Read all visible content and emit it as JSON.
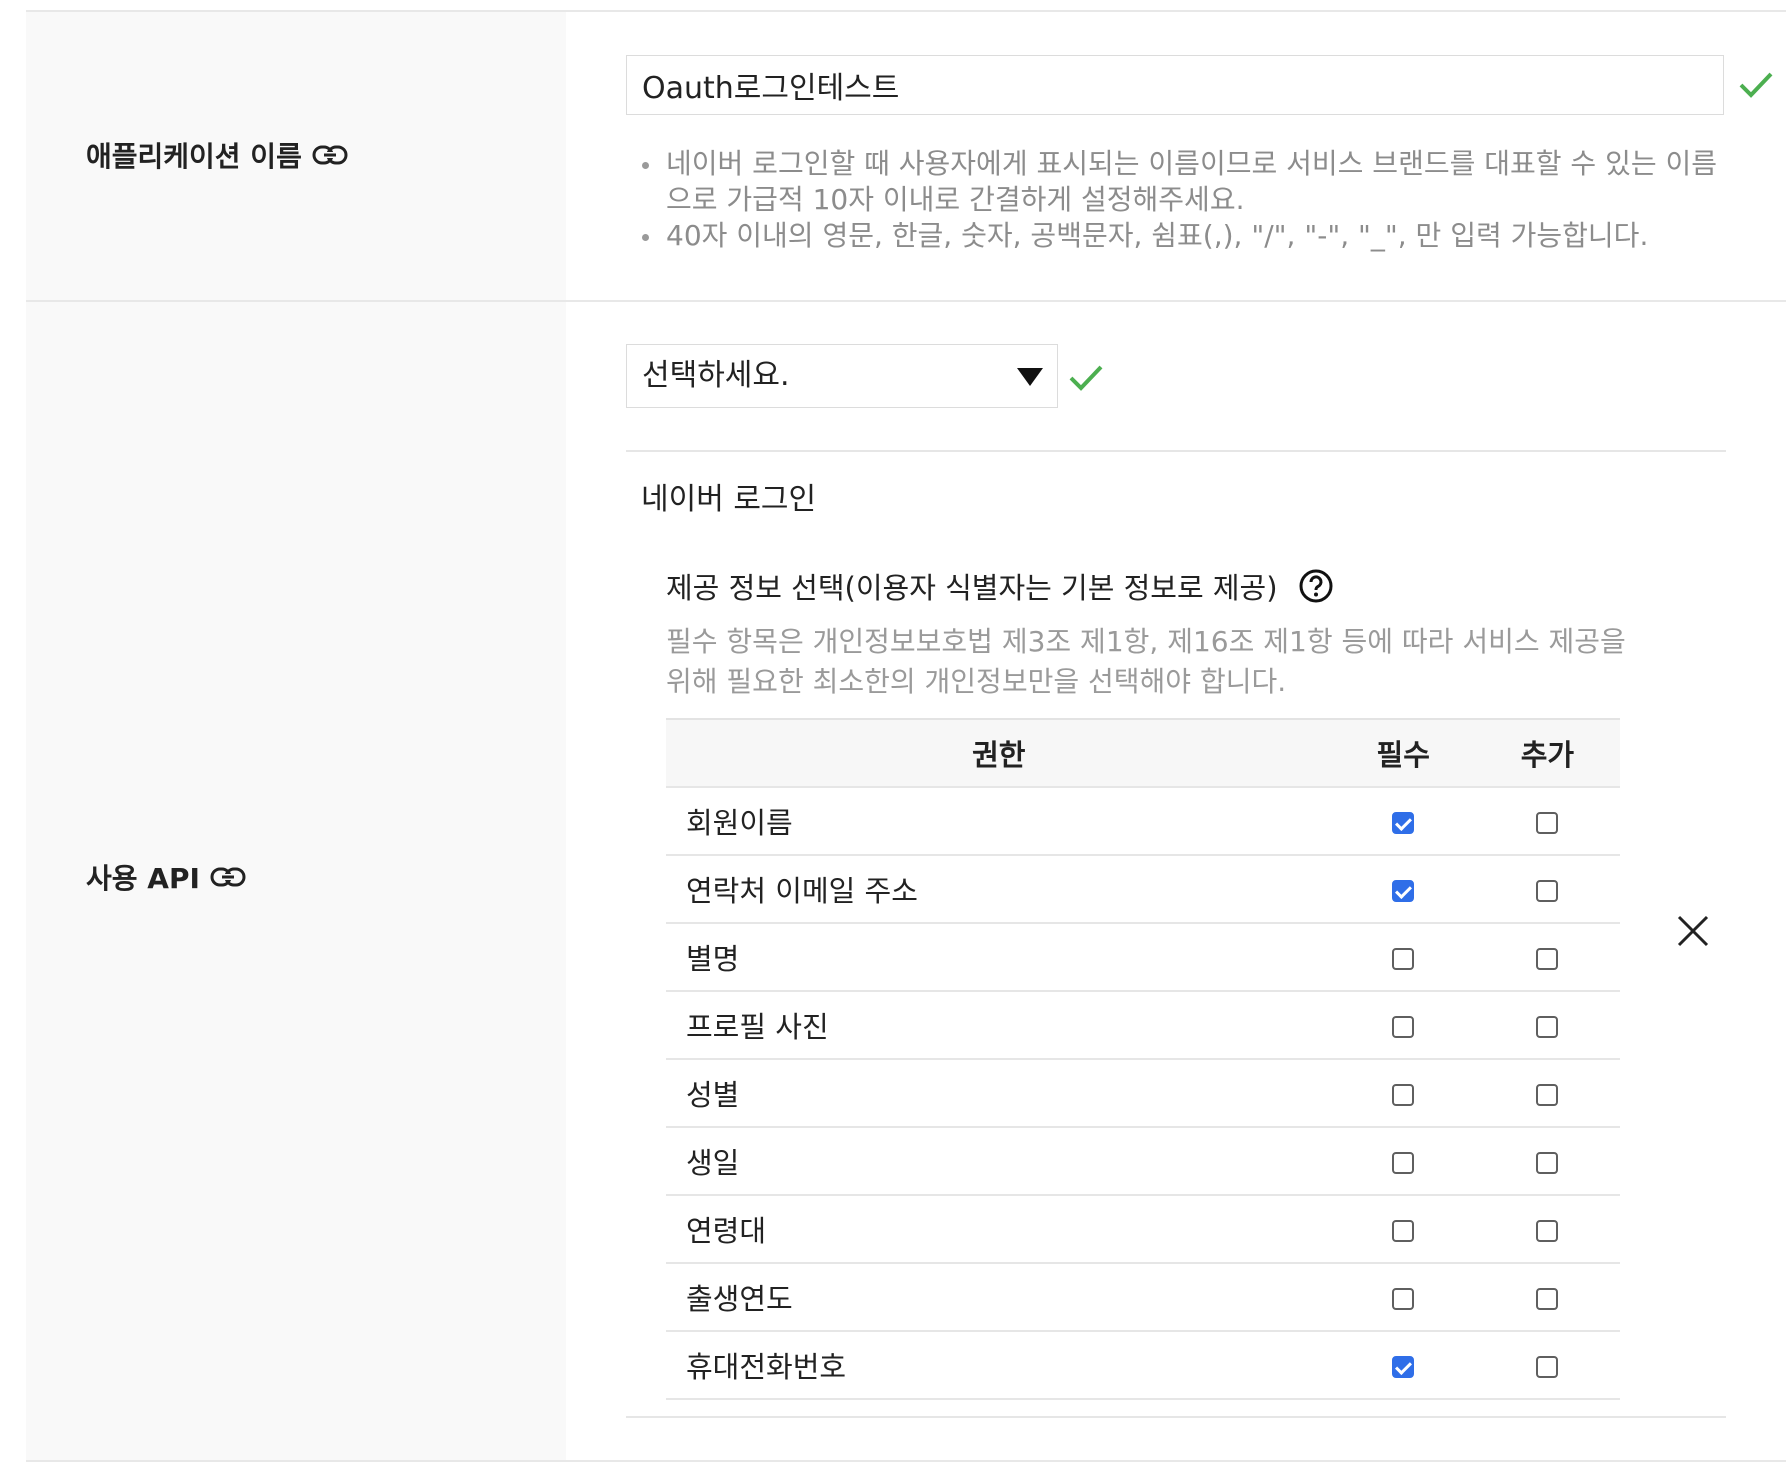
{
  "app_name_row": {
    "label": "애플리케이션 이름",
    "link_icon": "link-icon",
    "input_value": "Oauth로그인테스트",
    "valid_icon": "check-icon",
    "valid_color": "#4caf50",
    "hints": [
      "네이버 로그인할 때 사용자에게 표시되는 이름이므로 서비스 브랜드를 대표할 수 있는 이름으로 가급적 10자 이내로 간결하게 설정해주세요.",
      "40자 이내의 영문, 한글, 숫자, 공백문자, 쉼표(,), \"/\", \"-\", \"_\", 만 입력 가능합니다."
    ]
  },
  "api_row": {
    "label": "사용 API",
    "link_icon": "link-icon",
    "select_value": "선택하세요.",
    "valid_icon": "check-icon",
    "api_title": "네이버 로그인",
    "info_title": "제공 정보 선택(이용자 식별자는 기본 정보로 제공)",
    "help_icon": "question-circle-icon",
    "info_desc": "필수 항목은 개인정보보호법 제3조 제1항, 제16조 제1항 등에 따라 서비스 제공을 위해 필요한 최소한의 개인정보만을 선택해야 합니다.",
    "remove_icon": "close-icon",
    "table": {
      "headers": {
        "permission": "권한",
        "required": "필수",
        "optional": "추가"
      },
      "rows": [
        {
          "name": "회원이름",
          "required": true,
          "optional": false
        },
        {
          "name": "연락처 이메일 주소",
          "required": true,
          "optional": false
        },
        {
          "name": "별명",
          "required": false,
          "optional": false
        },
        {
          "name": "프로필 사진",
          "required": false,
          "optional": false
        },
        {
          "name": "성별",
          "required": false,
          "optional": false
        },
        {
          "name": "생일",
          "required": false,
          "optional": false
        },
        {
          "name": "연령대",
          "required": false,
          "optional": false
        },
        {
          "name": "출생연도",
          "required": false,
          "optional": false
        },
        {
          "name": "휴대전화번호",
          "required": true,
          "optional": false
        }
      ]
    },
    "checkbox_color": "#2f6ee8"
  }
}
